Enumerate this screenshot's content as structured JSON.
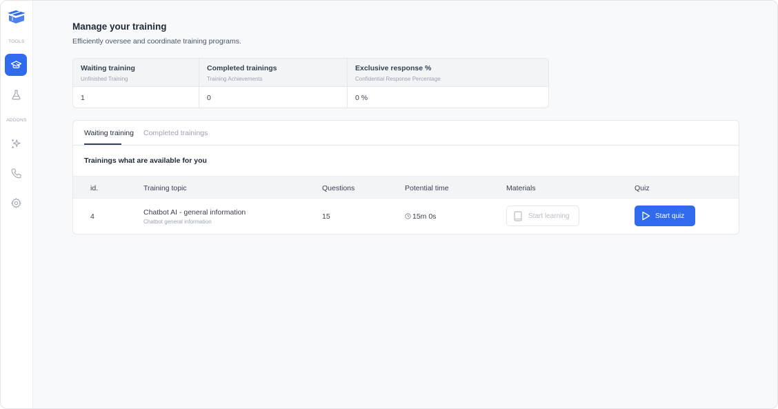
{
  "sidebar": {
    "section_tools": "TOOLS",
    "section_addons": "ADDONS",
    "items": [
      {
        "icon": "graduation-cap-icon",
        "active": true
      },
      {
        "icon": "flask-icon",
        "active": false
      },
      {
        "icon": "sparkles-icon",
        "active": false
      },
      {
        "icon": "phone-icon",
        "active": false
      },
      {
        "icon": "gear-icon",
        "active": false
      }
    ],
    "accent": "#2f6bec"
  },
  "header": {
    "title": "Manage your training",
    "subtitle": "Efficiently oversee and coordinate training programs."
  },
  "stats": [
    {
      "title": "Waiting training",
      "subtitle": "Unfinished Training",
      "value": "1"
    },
    {
      "title": "Completed trainings",
      "subtitle": "Training Achievements",
      "value": "0"
    },
    {
      "title": "Exclusive response %",
      "subtitle": "Confidential Response Percentage",
      "value": "0 %"
    }
  ],
  "tabs": [
    {
      "label": "Waiting training",
      "active": true
    },
    {
      "label": "Completed trainings",
      "active": false
    }
  ],
  "section_title": "Trainings what are available for you",
  "table": {
    "columns": [
      "id.",
      "Training topic",
      "Questions",
      "Potential time",
      "Materials",
      "Quiz"
    ],
    "rows": [
      {
        "id": "4",
        "topic": "Chatbot AI - general information",
        "topic_sub": "Chatbot general information",
        "questions": "15",
        "time": "15m 0s",
        "materials_label": "Start learning",
        "quiz_label": "Start quiz"
      }
    ]
  }
}
